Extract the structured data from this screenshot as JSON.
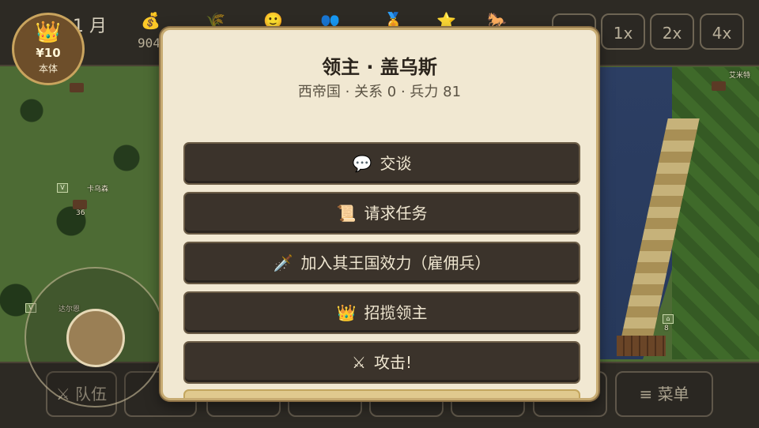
{
  "player": {
    "crown": "👑",
    "money": "¥10",
    "status": "本体"
  },
  "topbar": {
    "month": "1 月",
    "stats": [
      {
        "icon": "💰",
        "value": "904"
      },
      {
        "icon": "🌾",
        "value": ""
      },
      {
        "icon": "🙂",
        "value": ""
      },
      {
        "icon": "👥",
        "value": ""
      },
      {
        "icon": "🏅",
        "value": ""
      },
      {
        "icon": "⭐",
        "value": ""
      },
      {
        "icon": "🐎",
        "value": ""
      }
    ],
    "speed_buttons": [
      "",
      "1x",
      "2x",
      "4x"
    ]
  },
  "map": {
    "labels": [
      "卡乌森",
      "达尔恩",
      "艾米特"
    ],
    "flag_counts": [
      "36",
      "8"
    ]
  },
  "dialog": {
    "title": "领主 · 盖乌斯",
    "subtitle": "西帝国 · 关系 0 · 兵力 81",
    "actions": [
      {
        "icon": "💬",
        "label": "交谈"
      },
      {
        "icon": "📜",
        "label": "请求任务"
      },
      {
        "icon": "🗡️",
        "label": "加入其王国效力（雇佣兵）"
      },
      {
        "icon": "👑",
        "label": "招揽领主"
      },
      {
        "icon": "⚔",
        "label": "攻击!"
      }
    ]
  },
  "bottombar": {
    "party_label": "队伍",
    "party_icon": "⚔",
    "menu_label": "菜单",
    "menu_icon": "≡"
  }
}
